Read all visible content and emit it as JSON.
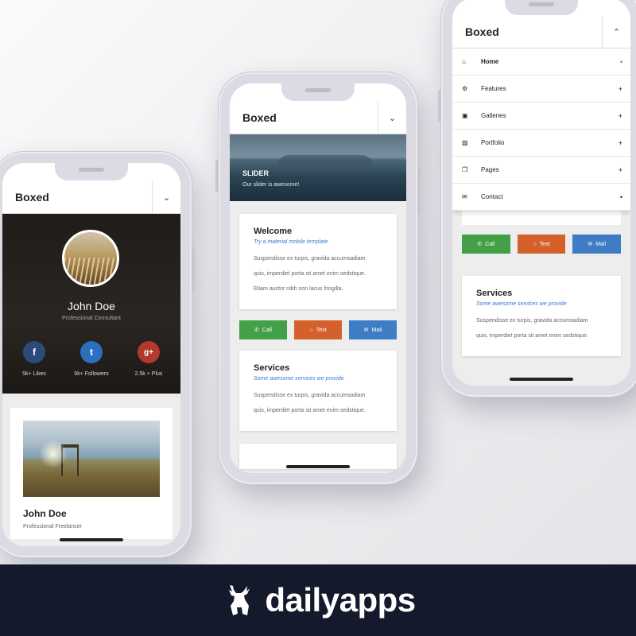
{
  "app": {
    "title": "Boxed",
    "toggle_icon_down": "chevron-down-icon",
    "toggle_icon_up": "chevron-up-icon"
  },
  "phone1": {
    "profile": {
      "name": "John Doe",
      "role": "Professional Consultant"
    },
    "socials": [
      {
        "icon": "facebook-icon",
        "glyph": "f",
        "label": "5k+ Likes",
        "color": "#2d4a7c"
      },
      {
        "icon": "twitter-icon",
        "glyph": "t",
        "label": "9k+ Followers",
        "color": "#2c6fbf"
      },
      {
        "icon": "google-plus-icon",
        "glyph": "g+",
        "label": "2.5k + Plus",
        "color": "#b3392d"
      }
    ],
    "card": {
      "name": "John Doe",
      "role": "Professional Freelancer"
    }
  },
  "phone2": {
    "slider": {
      "title": "SLIDER",
      "subtitle": "Our slider is awesome!"
    },
    "welcome": {
      "title": "Welcome",
      "subtitle": "Try a material mobile template",
      "lines": [
        "Suspendisse ex turpis, gravida accumsadiam",
        "quis, imperdiet porta sit amet enim sedstique.",
        "Etiam auctor nibh non lacus fringilla."
      ]
    },
    "actions": [
      {
        "label": "Call",
        "icon": "phone-icon",
        "glyph": "✆"
      },
      {
        "label": "Text",
        "icon": "chat-icon",
        "glyph": "○"
      },
      {
        "label": "Mail",
        "icon": "mail-icon",
        "glyph": "✉"
      }
    ],
    "services": {
      "title": "Services",
      "subtitle": "Some awesome services we provide",
      "lines": [
        "Suspendisse ex turpis, gravida accumsadiam",
        "quis, imperdiet porta sit amet enim sedstique."
      ]
    }
  },
  "phone3": {
    "menu": [
      {
        "label": "Home",
        "icon": "home-icon",
        "glyph": "⌂",
        "trail": "•",
        "active": true
      },
      {
        "label": "Features",
        "icon": "gear-icon",
        "glyph": "⚙",
        "trail": "+"
      },
      {
        "label": "Galleries",
        "icon": "camera-icon",
        "glyph": "▣",
        "trail": "+"
      },
      {
        "label": "Portfolio",
        "icon": "image-icon",
        "glyph": "▨",
        "trail": "+"
      },
      {
        "label": "Pages",
        "icon": "pages-icon",
        "glyph": "❐",
        "trail": "+"
      },
      {
        "label": "Contact",
        "icon": "envelope-icon",
        "glyph": "✉",
        "trail": "•"
      }
    ],
    "actions": [
      {
        "label": "Call",
        "icon": "phone-icon",
        "glyph": "✆"
      },
      {
        "label": "Text",
        "icon": "chat-icon",
        "glyph": "○"
      },
      {
        "label": "Mail",
        "icon": "mail-icon",
        "glyph": "✉"
      }
    ],
    "services": {
      "title": "Services",
      "subtitle": "Some awesome services we provide",
      "lines": [
        "Suspendisse ex turpis, gravida accumsadiam",
        "quis, imperdiet porta sit amet enim sedstique."
      ]
    }
  },
  "footer": {
    "brand": "dailyapps",
    "logo_icon": "deer-logo-icon"
  },
  "colors": {
    "call": "#43a047",
    "text": "#d4612c",
    "mail": "#3f7cc6",
    "footer_bg": "#141a2b",
    "accent_blue": "#3a7bd5"
  }
}
